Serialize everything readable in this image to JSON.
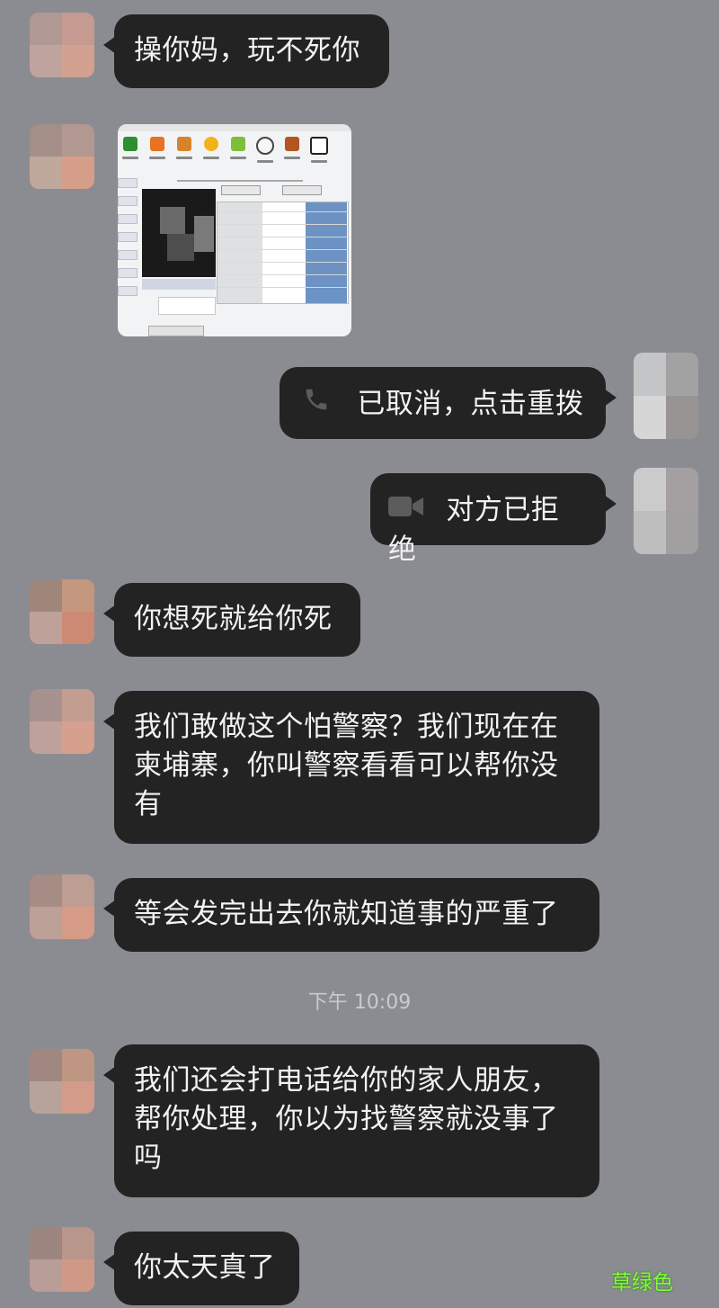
{
  "conversation": {
    "messages": [
      {
        "side": "left",
        "type": "text",
        "text": "操你妈，玩不死你"
      },
      {
        "side": "left",
        "type": "image",
        "description_icon": "software-screenshot-thumbnail"
      },
      {
        "side": "right",
        "type": "call",
        "icon": "phone-icon",
        "text": "已取消，点击重拨"
      },
      {
        "side": "right",
        "type": "call",
        "icon": "video-camera-icon",
        "text": "对方已拒绝"
      },
      {
        "side": "left",
        "type": "text",
        "text": "你想死就给你死"
      },
      {
        "side": "left",
        "type": "text",
        "lines": [
          "我们敢做这个怕警察？我们现在在",
          "柬埔寨，你叫警察看看可以帮你没",
          "有"
        ]
      },
      {
        "side": "left",
        "type": "text",
        "text": "等会发完出去你就知道事的严重了"
      },
      {
        "side": "left",
        "type": "text",
        "lines": [
          "我们还会打电话给你的家人朋友，",
          "帮你处理，你以为找警察就没事了",
          "吗"
        ]
      },
      {
        "side": "left",
        "type": "text",
        "text": "你太天真了"
      }
    ],
    "timestamp": "下午 10:09"
  },
  "watermark": "草绿色",
  "colors": {
    "background": "#8b8c91",
    "bubble": "#232323",
    "bubble_text": "#f2f2f2",
    "timestamp_text": "#c9cacd",
    "watermark": "#7bff3c"
  }
}
